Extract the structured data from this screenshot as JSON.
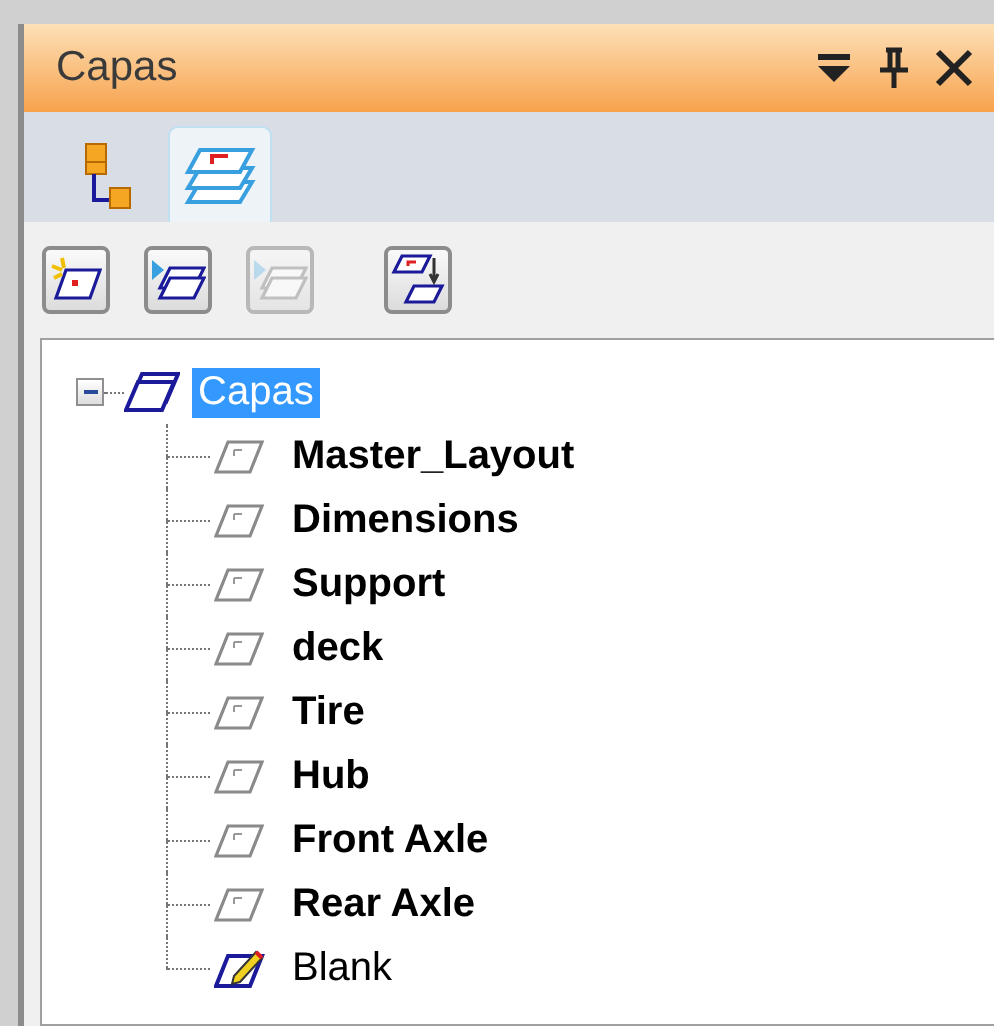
{
  "panel": {
    "title": "Capas"
  },
  "tabs": [
    {
      "kind": "tree",
      "selected": false
    },
    {
      "kind": "layers",
      "selected": true
    }
  ],
  "toolbar": [
    {
      "kind": "new",
      "disabled": false
    },
    {
      "kind": "show",
      "disabled": false
    },
    {
      "kind": "hide",
      "disabled": true
    },
    {
      "kind": "move",
      "disabled": false
    }
  ],
  "tree": {
    "label": "Capas",
    "selected": true,
    "expanded": true,
    "children": [
      {
        "label": "Master_Layout",
        "kind": "layer"
      },
      {
        "label": "Dimensions",
        "kind": "layer"
      },
      {
        "label": "Support",
        "kind": "layer"
      },
      {
        "label": "deck",
        "kind": "layer"
      },
      {
        "label": "Tire",
        "kind": "layer"
      },
      {
        "label": "Hub",
        "kind": "layer"
      },
      {
        "label": "Front Axle",
        "kind": "layer"
      },
      {
        "label": "Rear Axle",
        "kind": "layer"
      },
      {
        "label": "Blank",
        "kind": "active"
      }
    ]
  }
}
